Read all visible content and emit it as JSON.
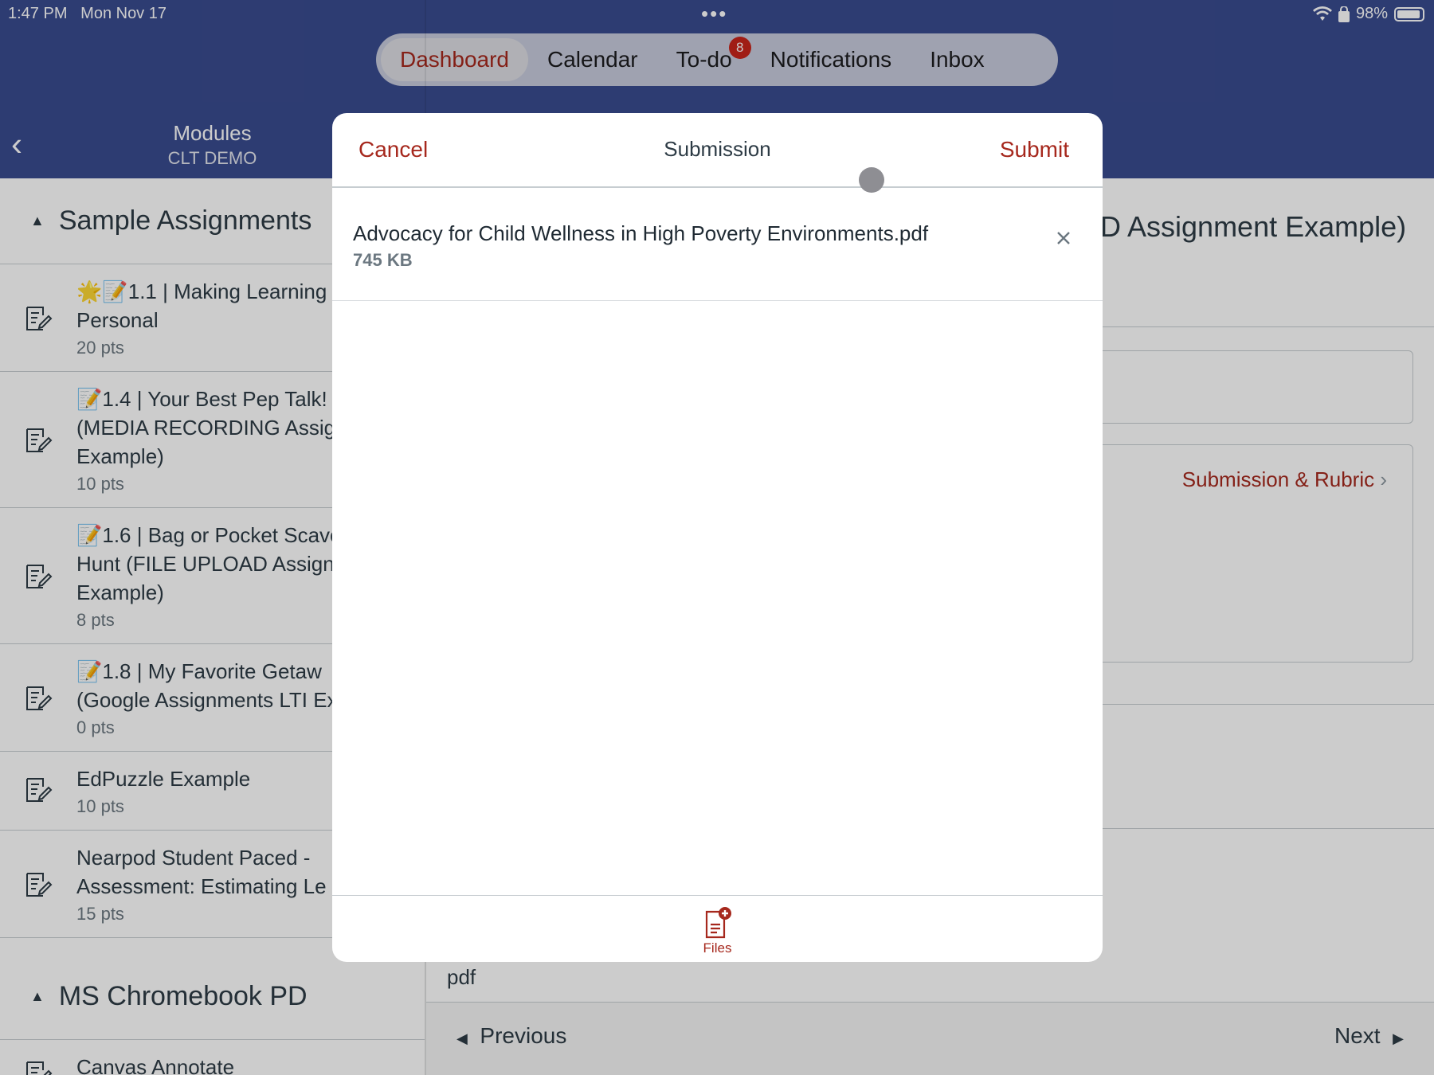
{
  "status_bar": {
    "time": "1:47 PM",
    "date": "Mon Nov 17",
    "battery": "98%"
  },
  "nav": {
    "tabs": [
      {
        "label": "Dashboard",
        "active": true
      },
      {
        "label": "Calendar",
        "active": false
      },
      {
        "label": "To-do",
        "active": false,
        "badge": "8"
      },
      {
        "label": "Notifications",
        "active": false
      },
      {
        "label": "Inbox",
        "active": false
      }
    ]
  },
  "left_header": {
    "title": "Modules",
    "subtitle": "CLT DEMO"
  },
  "sections": [
    {
      "title": "Sample Assignments",
      "items": [
        {
          "title": "🌟📝1.1 | Making Learning\nPersonal",
          "points": "20 pts"
        },
        {
          "title": "📝1.4 | Your Best Pep Talk!\n(MEDIA RECORDING Assig\nExample)",
          "points": "10 pts"
        },
        {
          "title": "📝1.6 | Bag or Pocket Scave\nHunt (FILE UPLOAD Assign\nExample)",
          "points": "8 pts"
        },
        {
          "title": "📝1.8 | My Favorite Getaw\n(Google Assignments LTI Ex",
          "points": "0 pts"
        },
        {
          "title": "EdPuzzle Example",
          "points": "10 pts"
        },
        {
          "title": "Nearpod Student Paced -\nAssessment: Estimating Le",
          "points": "15 pts"
        }
      ]
    },
    {
      "title": "MS Chromebook PD",
      "items": [
        {
          "title": "Canvas Annotate",
          "points": ""
        }
      ]
    }
  ],
  "right_panel": {
    "title_fragment": "D Assignment Example)",
    "rubric_link": "Submission & Rubric",
    "file_type": "pdf",
    "previous": "Previous",
    "next": "Next"
  },
  "modal": {
    "cancel": "Cancel",
    "title": "Submission",
    "submit": "Submit",
    "file": {
      "name": "Advocacy for Child Wellness in High Poverty Environments.pdf",
      "size": "745 KB"
    },
    "files_button": "Files"
  },
  "colors": {
    "brand": "#394b8f",
    "accent": "#a6281d",
    "badge": "#c9251b"
  }
}
